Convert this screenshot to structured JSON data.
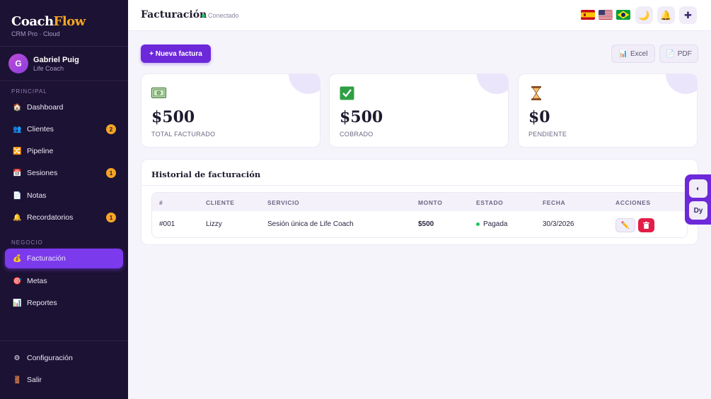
{
  "brand": {
    "name_part1": "Coach",
    "name_part2": "Flow",
    "subtitle": "CRM Pro · Cloud"
  },
  "user": {
    "initial": "G",
    "name": "Gabriel Puig",
    "role": "Life Coach"
  },
  "sidebar": {
    "section_principal": "PRINCIPAL",
    "section_negocio": "NEGOCIO",
    "items": [
      {
        "label": "Dashboard",
        "icon": "home-icon",
        "glyph": "🏠"
      },
      {
        "label": "Clientes",
        "icon": "users-icon",
        "glyph": "👥",
        "badge": "2"
      },
      {
        "label": "Pipeline",
        "icon": "pipeline-icon",
        "glyph": "🔀"
      },
      {
        "label": "Sesiones",
        "icon": "calendar-icon",
        "glyph": "📅",
        "badge": "1"
      },
      {
        "label": "Notas",
        "icon": "note-icon",
        "glyph": "📄"
      },
      {
        "label": "Recordatorios",
        "icon": "bell-icon",
        "glyph": "🔔",
        "badge": "1"
      },
      {
        "label": "Facturación",
        "icon": "money-bag-icon",
        "glyph": "💰",
        "active": true
      },
      {
        "label": "Metas",
        "icon": "target-icon",
        "glyph": "🎯"
      },
      {
        "label": "Reportes",
        "icon": "chart-icon",
        "glyph": "📊"
      }
    ],
    "footer": [
      {
        "label": "Configuración",
        "icon": "gear-icon",
        "glyph": "⚙"
      },
      {
        "label": "Salir",
        "icon": "door-icon",
        "glyph": "🚪"
      }
    ]
  },
  "header": {
    "title": "Facturación",
    "status": "Conectado",
    "languages": [
      "es",
      "us",
      "br"
    ],
    "theme_glyph": "🌙",
    "bell_glyph": "🔔",
    "add_glyph": "✚"
  },
  "toolbar": {
    "new_invoice": "+ Nueva factura",
    "excel": "Excel",
    "pdf": "PDF"
  },
  "stats": [
    {
      "icon": "money-icon",
      "amount": "$500",
      "label": "TOTAL FACTURADO"
    },
    {
      "icon": "check-icon",
      "amount": "$500",
      "label": "COBRADO"
    },
    {
      "icon": "hourglass-icon",
      "amount": "$0",
      "label": "PENDIENTE"
    }
  ],
  "history": {
    "title": "Historial de facturación",
    "columns": [
      "#",
      "CLIENTE",
      "SERVICIO",
      "MONTO",
      "ESTADO",
      "FECHA",
      "ACCIONES"
    ],
    "rows": [
      {
        "id": "#001",
        "client": "Lizzy",
        "service": "Sesión única de Life Coach",
        "amount": "$500",
        "status": "Pagada",
        "date": "30/3/2026"
      }
    ]
  },
  "dock": {
    "contrast_glyph": "◐",
    "dy_label": "Dy"
  },
  "colors": {
    "sidebar_bg": "#1c1233",
    "accent": "#6d28d9",
    "brand_accent": "#f5a524",
    "paid": "#22c55e",
    "danger": "#e11d48"
  }
}
